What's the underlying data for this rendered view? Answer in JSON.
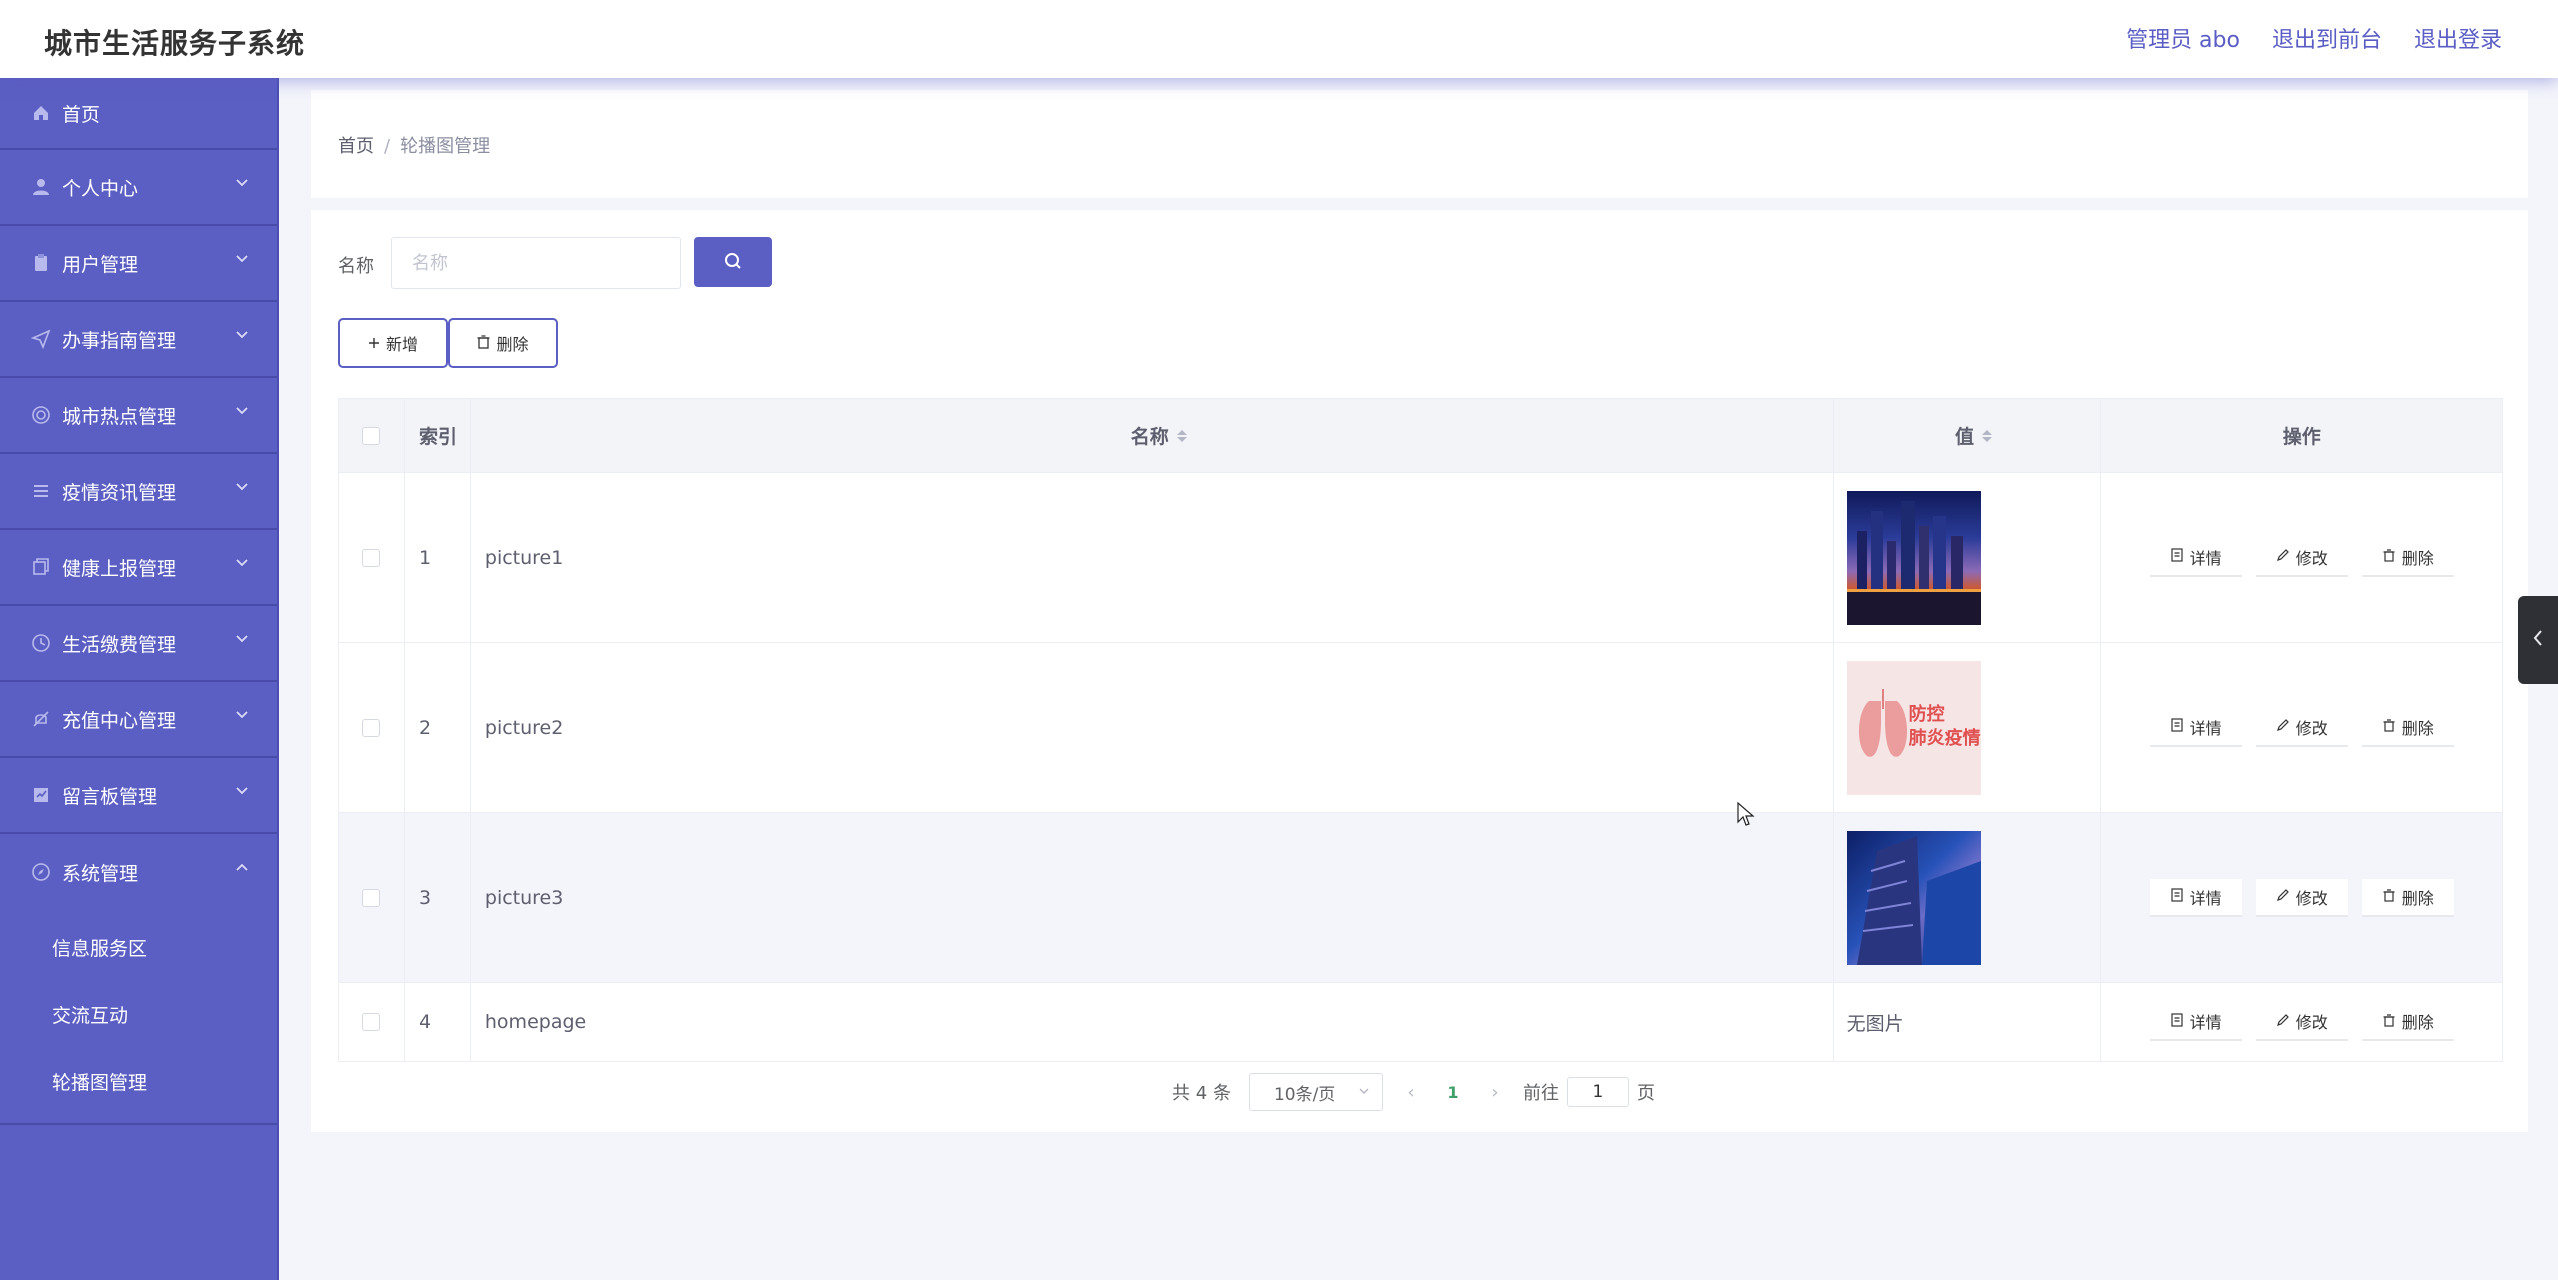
{
  "header": {
    "title": "城市生活服务子系统",
    "admin": "管理员 abo",
    "to_front": "退出到前台",
    "logout": "退出登录"
  },
  "sidebar": {
    "items": [
      {
        "label": "首页",
        "icon": "home-icon"
      },
      {
        "label": "个人中心",
        "icon": "user-icon"
      },
      {
        "label": "用户管理",
        "icon": "clipboard-icon"
      },
      {
        "label": "办事指南管理",
        "icon": "send-icon"
      },
      {
        "label": "城市热点管理",
        "icon": "target-icon"
      },
      {
        "label": "疫情资讯管理",
        "icon": "list-icon"
      },
      {
        "label": "健康上报管理",
        "icon": "copy-icon"
      },
      {
        "label": "生活缴费管理",
        "icon": "clock-icon"
      },
      {
        "label": "充值中心管理",
        "icon": "no-bell-icon"
      },
      {
        "label": "留言板管理",
        "icon": "chat-icon"
      },
      {
        "label": "系统管理",
        "icon": "compass-icon"
      }
    ],
    "submenu": [
      "信息服务区",
      "交流互动",
      "轮播图管理"
    ]
  },
  "breadcrumb": {
    "home": "首页",
    "sep": "/",
    "current": "轮播图管理"
  },
  "search": {
    "label": "名称",
    "placeholder": "名称",
    "value": ""
  },
  "actions": {
    "add": "新增",
    "delete": "删除"
  },
  "table": {
    "headers": {
      "index": "索引",
      "name": "名称",
      "value": "值",
      "ops": "操作"
    },
    "rows": [
      {
        "index": "1",
        "name": "picture1",
        "value": "image"
      },
      {
        "index": "2",
        "name": "picture2",
        "value": "image"
      },
      {
        "index": "3",
        "name": "picture3",
        "value": "image"
      },
      {
        "index": "4",
        "name": "homepage",
        "value": "无图片"
      }
    ],
    "thumb2_text": "防控\n肺炎疫情",
    "row_ops": {
      "detail": "详情",
      "edit": "修改",
      "delete": "删除"
    }
  },
  "pagination": {
    "total": "共 4 条",
    "page_size": "10条/页",
    "current_page": "1",
    "goto_label": "前往",
    "goto_value": "1",
    "page_unit": "页"
  },
  "colors": {
    "accent": "#5b5ec2",
    "sidebar": "#5b5ec2",
    "page_bg": "#f4f5fb"
  }
}
